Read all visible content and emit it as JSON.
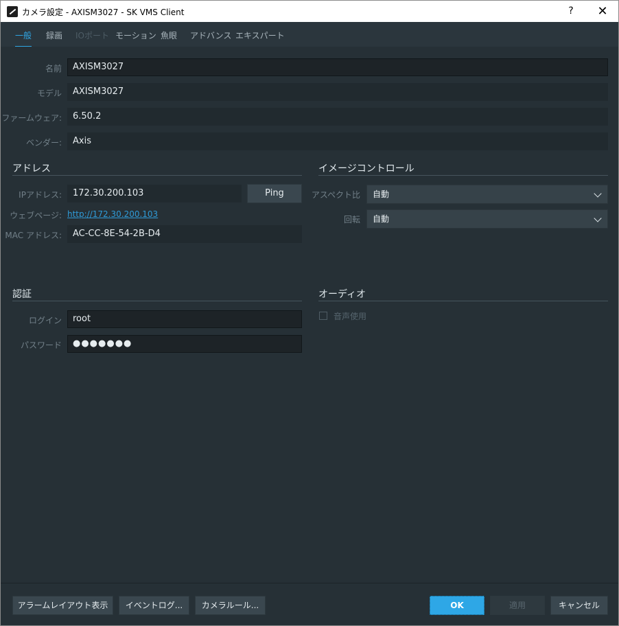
{
  "window": {
    "title": "カメラ設定 - AXISM3027 - SK VMS Client",
    "help_label": "?",
    "close_label": "✕"
  },
  "tabs": [
    {
      "label": "一般",
      "state": "active"
    },
    {
      "label": "録画",
      "state": "normal"
    },
    {
      "label": "IOポート",
      "state": "disabled"
    },
    {
      "label": "モーション",
      "state": "normal"
    },
    {
      "label": "魚眼",
      "state": "normal"
    },
    {
      "label": "アドバンス",
      "state": "normal"
    },
    {
      "label": "エキスパート",
      "state": "normal"
    }
  ],
  "general": {
    "name_label": "名前",
    "name_value": "AXISM3027",
    "model_label": "モデル",
    "model_value": "AXISM3027",
    "firmware_label": "ファームウェア:",
    "firmware_value": "6.50.2",
    "vendor_label": "ベンダー:",
    "vendor_value": "Axis"
  },
  "address": {
    "title": "アドレス",
    "ip_label": "IPアドレス:",
    "ip_value": "172.30.200.103",
    "ping_label": "Ping",
    "web_label": "ウェブページ:",
    "web_link": "http://172.30.200.103",
    "mac_label": "MAC アドレス:",
    "mac_value": "AC-CC-8E-54-2B-D4"
  },
  "image_control": {
    "title": "イメージコントロール",
    "aspect_label": "アスペクト比",
    "aspect_value": "自動",
    "rotation_label": "回転",
    "rotation_value": "自動"
  },
  "auth": {
    "title": "認証",
    "login_label": "ログイン",
    "login_value": "root",
    "password_label": "パスワード",
    "password_value": "●●●●●●●"
  },
  "audio": {
    "title": "オーディオ",
    "enable_label": "音声使用",
    "enable_checked": false
  },
  "footer": {
    "alarm_layout": "アラームレイアウト表示",
    "event_log": "イベントログ...",
    "camera_rules": "カメラルール...",
    "ok": "OK",
    "apply": "適用",
    "cancel": "キャンセル"
  },
  "colors": {
    "accent": "#2fa7e6",
    "background": "#263036",
    "tab_bar": "#2b363d",
    "field": "#1d2327"
  }
}
